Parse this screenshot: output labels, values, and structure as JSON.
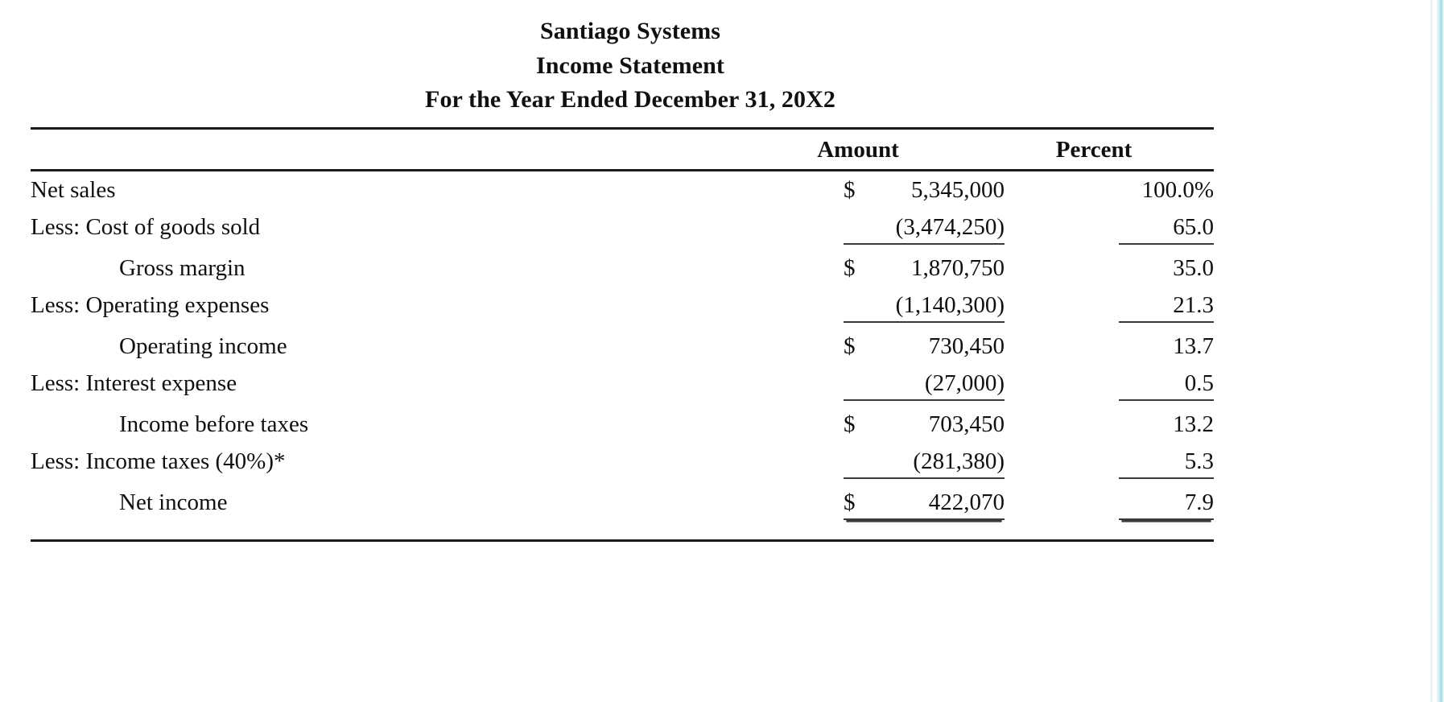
{
  "document": {
    "company": "Santiago Systems",
    "statement_title": "Income Statement",
    "period": "For the Year Ended December 31, 20X2"
  },
  "table": {
    "headers": {
      "label": "",
      "amount": "Amount",
      "percent": "Percent"
    },
    "rows": [
      {
        "label": "Net sales",
        "indent": false,
        "currency": "$",
        "amount": "5,345,000",
        "percent": "100.0%",
        "underline": "none"
      },
      {
        "label": "Less: Cost of goods sold",
        "indent": false,
        "currency": "",
        "amount": "(3,474,250)",
        "percent": "65.0",
        "underline": "single"
      },
      {
        "label": "Gross margin",
        "indent": true,
        "currency": "$",
        "amount": "1,870,750",
        "percent": "35.0",
        "underline": "none"
      },
      {
        "label": "Less: Operating expenses",
        "indent": false,
        "currency": "",
        "amount": "(1,140,300)",
        "percent": "21.3",
        "underline": "single"
      },
      {
        "label": "Operating income",
        "indent": true,
        "currency": "$",
        "amount": "730,450",
        "percent": "13.7",
        "underline": "none"
      },
      {
        "label": "Less: Interest expense",
        "indent": false,
        "currency": "",
        "amount": "(27,000)",
        "percent": "0.5",
        "underline": "single"
      },
      {
        "label": "Income before taxes",
        "indent": true,
        "currency": "$",
        "amount": "703,450",
        "percent": "13.2",
        "underline": "none"
      },
      {
        "label": "Less: Income taxes (40%)*",
        "indent": false,
        "currency": "",
        "amount": "(281,380)",
        "percent": "5.3",
        "underline": "single"
      },
      {
        "label": "Net income",
        "indent": true,
        "currency": "$",
        "amount": "422,070",
        "percent": "7.9",
        "underline": "double"
      }
    ]
  },
  "chart_data": {
    "type": "table",
    "title": "Santiago Systems Income Statement — For the Year Ended December 31, 20X2",
    "categories": [
      "Net sales",
      "Less: Cost of goods sold",
      "Gross margin",
      "Less: Operating expenses",
      "Operating income",
      "Less: Interest expense",
      "Income before taxes",
      "Less: Income taxes (40%)*",
      "Net income"
    ],
    "series": [
      {
        "name": "Amount",
        "values": [
          5345000,
          -3474250,
          1870750,
          -1140300,
          730450,
          -27000,
          703450,
          -281380,
          422070
        ]
      },
      {
        "name": "Percent",
        "values": [
          100.0,
          65.0,
          35.0,
          21.3,
          13.7,
          0.5,
          13.2,
          5.3,
          7.9
        ]
      }
    ]
  }
}
